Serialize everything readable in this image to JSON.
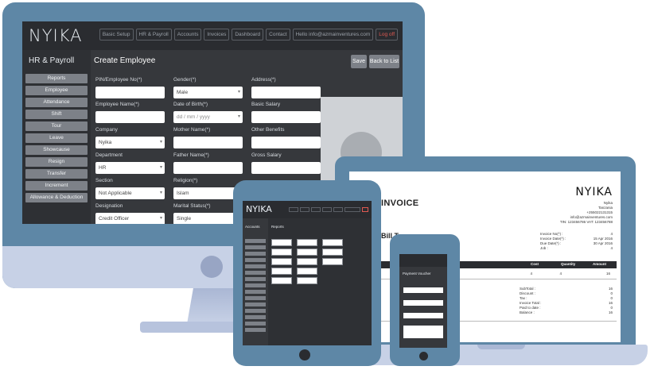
{
  "brand": {
    "logo_text": "NYIKA",
    "colors": {
      "device_frame": "#5e87a6",
      "device_body": "#c7d1e6",
      "screen_dark": "#36383c",
      "button_gray": "#7d8188",
      "logout_red": "#e05a52"
    }
  },
  "desktop": {
    "nav": [
      "Basic Setup",
      "HR & Payroll",
      "Accounts",
      "Invoices",
      "Dashboard",
      "Contact",
      "Hello info@azmainventures.com",
      "Log off"
    ],
    "sidebar_title": "HR & Payroll",
    "sidebar_items": [
      "Reports",
      "Employee",
      "Attendance",
      "Shift",
      "Tour",
      "Leave",
      "Showcause",
      "Resign",
      "Transfer",
      "Increment",
      "Allowance & Deduction"
    ],
    "page_title": "Create Employee",
    "save_label": "Save",
    "back_label": "Back to List",
    "form": {
      "pin_label": "PIN/Employee No(*)",
      "pin_value": "",
      "gender_label": "Gender(*)",
      "gender_value": "Male",
      "address_label": "Address(*)",
      "address_value": "",
      "name_label": "Employee Name(*)",
      "name_value": "",
      "dob_label": "Date of Birth(*)",
      "dob_placeholder": "dd / mm / yyyy",
      "basic_salary_label": "Basic Salary",
      "basic_salary_value": "",
      "company_label": "Company",
      "company_value": "Nyika",
      "mother_label": "Mother Name(*)",
      "mother_value": "",
      "other_benefits_label": "Other Benefits",
      "other_benefits_value": "",
      "department_label": "Department",
      "department_value": "HR",
      "father_label": "Father Name(*)",
      "father_value": "",
      "gross_salary_label": "Gross Salary",
      "gross_salary_value": "",
      "section_label": "Section",
      "section_value": "Not Applicable",
      "religion_label": "Religion(*)",
      "religion_value": "Islam",
      "designation_label": "Designation",
      "designation_value": "Credit Officer",
      "marital_label": "Marital Status(*)",
      "marital_value": "Single"
    }
  },
  "laptop": {
    "invoice_title": "INVOICE",
    "logo_text": "NYIKA",
    "company_lines": [
      "Nyika",
      "Tanzania",
      "+255022131315",
      "info@azmainventures.com",
      "TIN: 123456786 VAT: 123456788"
    ],
    "meta_labels": [
      "Invoice No(*) :",
      "Invoice Date(*) :",
      "Due Date(*) :",
      "Job :"
    ],
    "meta_values": [
      "4",
      "15 Apr 2016",
      "30 Apr 2016",
      "4"
    ],
    "bill_to": "Bill To",
    "table_headers": [
      "Cost",
      "Quantity",
      "Amount"
    ],
    "row_values": [
      "4",
      "4",
      "16"
    ],
    "totals_labels": [
      "SubTotal :",
      "Discount :",
      "Tax :",
      "Invoice Total :",
      "Paid to date :",
      "Balance :"
    ],
    "totals_values": [
      "16",
      "0",
      "0",
      "16",
      "0",
      "16"
    ]
  },
  "tablet": {
    "logo_text": "NYIKA",
    "sidebar_title": "Accounts",
    "main_title": "Reports"
  },
  "phone": {
    "title": "Payment Voucher"
  }
}
